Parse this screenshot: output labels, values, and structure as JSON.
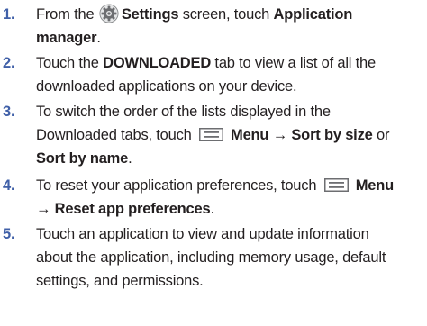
{
  "steps": [
    {
      "number": "1.",
      "line1": {
        "pre": "From the ",
        "icon": "settings-gear-icon",
        "bold": "Settings",
        "post": " screen, touch ",
        "bold2": "Application"
      },
      "line2": {
        "bold": "manager",
        "post": "."
      }
    },
    {
      "number": "2.",
      "line1": {
        "pre": "Touch the ",
        "bold": "DOWNLOADED",
        "post": " tab to view a list of all the"
      },
      "line2": {
        "text": "downloaded applications on your device."
      }
    },
    {
      "number": "3.",
      "line1": {
        "text": "To switch the order of the lists displayed in the"
      },
      "line2": {
        "pre": "Downloaded tabs, touch ",
        "icon": "menu-key-icon",
        "bold": "Menu → Sort by size",
        "post": " or"
      },
      "line3": {
        "bold": "Sort by name",
        "post": "."
      }
    },
    {
      "number": "4.",
      "line1": {
        "pre": "To reset your application preferences, touch ",
        "icon": "menu-key-icon",
        "bold": "Menu"
      },
      "line2": {
        "bold": "→ Reset app preferences",
        "post": "."
      }
    },
    {
      "number": "5.",
      "line1": {
        "text": "Touch an application to view and update information"
      },
      "line2": {
        "text": "about the application, including memory usage, default"
      },
      "line3": {
        "text": "settings, and permissions."
      }
    }
  ]
}
